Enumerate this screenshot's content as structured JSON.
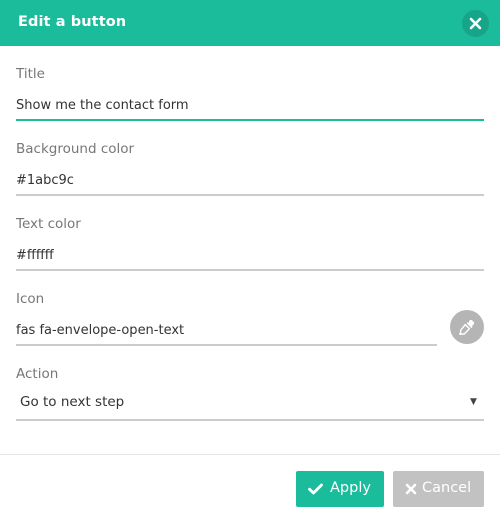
{
  "dialog": {
    "title": "Edit a button",
    "close_icon": "close-icon",
    "colors": {
      "accent": "#1abc9c",
      "muted_button": "#c2c2c2",
      "icon_button": "#b5b5b5"
    }
  },
  "fields": {
    "title": {
      "label": "Title",
      "value": "Show me the contact form"
    },
    "background_color": {
      "label": "Background color",
      "value": "#1abc9c"
    },
    "text_color": {
      "label": "Text color",
      "value": "#ffffff"
    },
    "icon": {
      "label": "Icon",
      "value": "fas fa-envelope-open-text",
      "picker_icon": "eyedropper-icon"
    },
    "action": {
      "label": "Action",
      "selected": "Go to next step"
    }
  },
  "footer": {
    "apply_label": "Apply",
    "apply_icon": "check-icon",
    "cancel_label": "Cancel",
    "cancel_icon": "times-icon"
  }
}
